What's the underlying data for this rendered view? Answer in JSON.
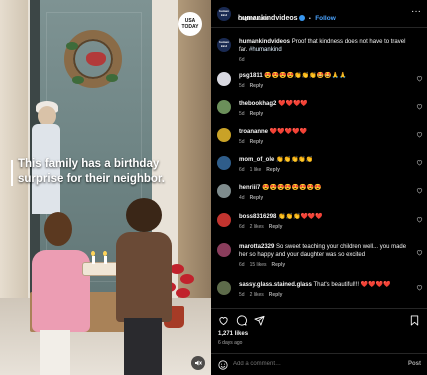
{
  "video": {
    "caption": "This family has a birthday surprise for their neighbor.",
    "badge_line1": "USA",
    "badge_line2": "TODAY"
  },
  "header": {
    "username": "humankindvideos",
    "follow_label": "Follow",
    "subtitle": "Original audio",
    "more_icon": "more-horizontal-icon"
  },
  "post_caption": {
    "username": "humankindvideos",
    "text": "Proof that kindness does not have to travel far. ",
    "hashtag": "#humankind",
    "age": "6d"
  },
  "comments": [
    {
      "username": "psg1811",
      "text": "😍😍😍😍👏👏👏🤩🤩🙏🙏",
      "age": "5d",
      "likes": "",
      "reply_label": "Reply",
      "avatar_color": "#d8d8e0"
    },
    {
      "username": "thebookhag2",
      "text": "❤️❤️❤️❤️",
      "age": "5d",
      "likes": "",
      "reply_label": "Reply",
      "avatar_color": "#6b8f5a"
    },
    {
      "username": "troananne",
      "text": "❤️❤️❤️❤️❤️",
      "age": "5d",
      "likes": "",
      "reply_label": "Reply",
      "avatar_color": "#c9a227"
    },
    {
      "username": "mom_of_ole",
      "text": "👏👏👏👏👏",
      "age": "6d",
      "likes": "1 like",
      "reply_label": "Reply",
      "avatar_color": "#2f5d8a"
    },
    {
      "username": "henriii7",
      "text": "😍😍😍😍😍😍😍😍",
      "age": "4d",
      "likes": "",
      "reply_label": "Reply",
      "avatar_color": "#7f8c8d"
    },
    {
      "username": "boss8316298",
      "text": "👏👏👏❤️❤️❤️",
      "age": "6d",
      "likes": "2 likes",
      "reply_label": "Reply",
      "avatar_color": "#c2342f"
    },
    {
      "username": "marotta2329",
      "text": "So sweet teaching your children well... you made her so happy and your daughter was so excited",
      "age": "6d",
      "likes": "15 likes",
      "reply_label": "Reply",
      "avatar_color": "#8a3d5c"
    },
    {
      "username": "sassy.glass.stained.glass",
      "text": "That's beautiful!!! ❤️❤️❤️❤️",
      "age": "5d",
      "likes": "2 likes",
      "reply_label": "Reply",
      "avatar_color": "#5d6b4a"
    }
  ],
  "footer": {
    "likes": "1,271 likes",
    "date": "6 days ago",
    "add_comment_placeholder": "Add a comment…",
    "post_label": "Post"
  },
  "colors": {
    "background": "#000000",
    "link_blue": "#4aa3ff",
    "muted_text": "#a8a8a8",
    "heart_red": "#ed4956"
  }
}
